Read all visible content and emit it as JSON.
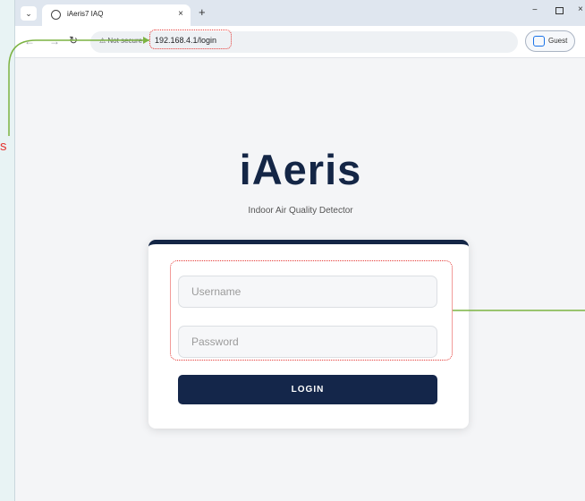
{
  "browser": {
    "tab_title": "iAeris7 IAQ",
    "tab_close": "×",
    "new_tab": "+",
    "security_label": "⚠ Not secure",
    "url": "192.168.4.1/login",
    "profile_label": "Guest",
    "window_min": "−",
    "window_close": "×",
    "icons": [
      "tab-search-icon",
      "site-favicon-icon",
      "back-arrow-icon",
      "forward-arrow-icon",
      "reload-icon",
      "guest-profile-icon"
    ]
  },
  "page": {
    "brand": "iAeris",
    "tagline": "Indoor Air Quality Detector",
    "username_placeholder": "Username",
    "password_placeholder": "Password",
    "login_label": "LOGIN"
  },
  "annotations": {
    "left_text": "s",
    "line_color": "#7cb342",
    "highlight_color": "#e53935"
  },
  "colors": {
    "brand": "#142646",
    "button": "#14264a",
    "card_border_top": "#142646"
  }
}
